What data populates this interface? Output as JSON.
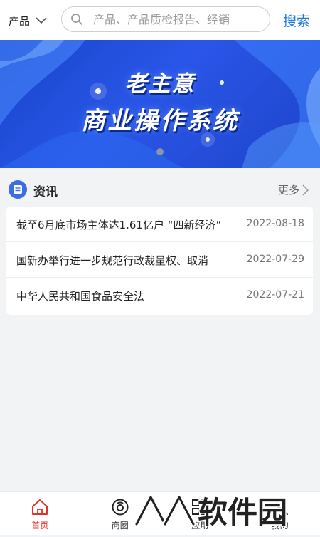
{
  "header": {
    "category_label": "产品",
    "search_placeholder": "产品、产品质检报告、经销",
    "search_button": "搜索"
  },
  "banner": {
    "title_line1": "老主意",
    "title_line2": "商业操作系统"
  },
  "news": {
    "title": "资讯",
    "more_label": "更多",
    "items": [
      {
        "title": "截至6月底市场主体达1.61亿户 “四新经济”",
        "date": "2022-08-18"
      },
      {
        "title": "国新办举行进一步规范行政裁量权、取消",
        "date": "2022-07-29"
      },
      {
        "title": "中华人民共和国食品安全法",
        "date": "2022-07-21"
      }
    ]
  },
  "tabbar": {
    "active_color": "#e0322a",
    "tabs": [
      {
        "label": "首页",
        "icon": "home-icon",
        "active": true
      },
      {
        "label": "商圈",
        "icon": "circle-icon",
        "active": false
      },
      {
        "label": "应用",
        "icon": "apps-icon",
        "active": false
      },
      {
        "label": "我的",
        "icon": "user-icon",
        "active": false
      }
    ]
  },
  "watermark": {
    "text": "软件园"
  },
  "colors": {
    "accent": "#1f7ae0",
    "banner": "#1d44c9",
    "news_icon": "#3b6ee0"
  }
}
